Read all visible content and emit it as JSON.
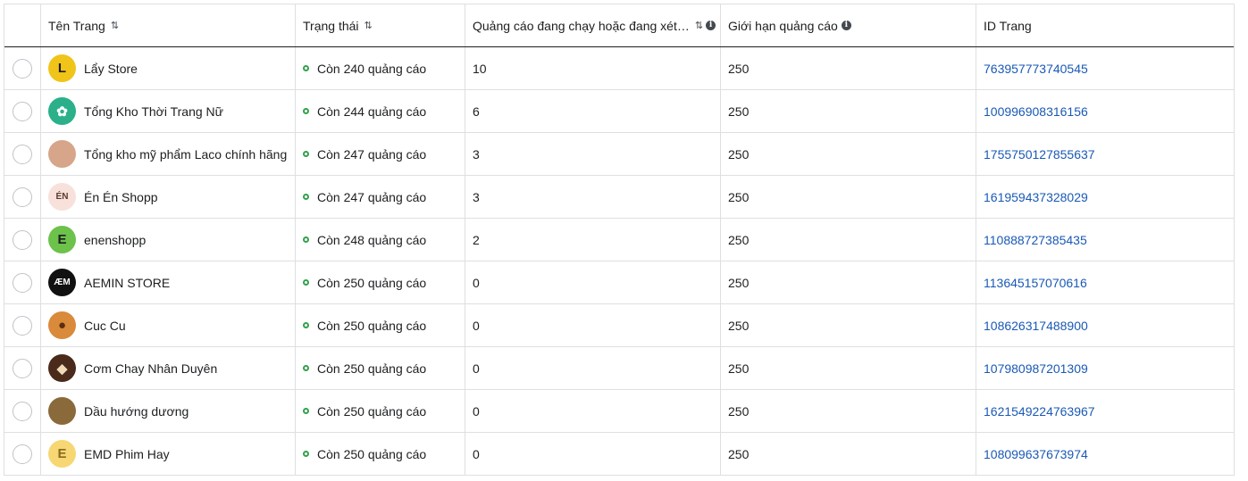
{
  "columns": {
    "name": "Tên Trang",
    "status": "Trạng thái",
    "ads_running": "Quảng cáo đang chạy hoặc đang xét…",
    "ad_limit": "Giới hạn quảng cáo",
    "page_id": "ID Trang"
  },
  "icons": {
    "sort": "sort-icon",
    "info": "info-icon",
    "status": "status-dot-icon"
  },
  "colors": {
    "status_green": "#31a24c",
    "link_blue": "#1a59b5",
    "border": "#dddfe2"
  },
  "rows": [
    {
      "name": "Lẩy Store",
      "status": "Còn 240 quảng cáo",
      "ads_running": "10",
      "ad_limit": "250",
      "page_id": "763957773740545",
      "avatar_text": "L",
      "avatar_bg": "#f0c419",
      "avatar_fg": "#1c1e21"
    },
    {
      "name": "Tổng Kho Thời Trang Nữ",
      "status": "Còn 244 quảng cáo",
      "ads_running": "6",
      "ad_limit": "250",
      "page_id": "100996908316156",
      "avatar_text": "✿",
      "avatar_bg": "#2bb08a",
      "avatar_fg": "#ffffff"
    },
    {
      "name": "Tổng kho mỹ phẩm Laco chính hãng",
      "status": "Còn 247 quảng cáo",
      "ads_running": "3",
      "ad_limit": "250",
      "page_id": "1755750127855637",
      "avatar_text": "",
      "avatar_bg": "#d6a58a",
      "avatar_fg": "#ffffff"
    },
    {
      "name": "Én Én Shopp",
      "status": "Còn 247 quảng cáo",
      "ads_running": "3",
      "ad_limit": "250",
      "page_id": "161959437328029",
      "avatar_text": "ÉN",
      "avatar_bg": "#f7e1da",
      "avatar_fg": "#5a3b2e"
    },
    {
      "name": "enenshopp",
      "status": "Còn 248 quảng cáo",
      "ads_running": "2",
      "ad_limit": "250",
      "page_id": "110888727385435",
      "avatar_text": "E",
      "avatar_bg": "#6cc24a",
      "avatar_fg": "#1c1e21"
    },
    {
      "name": "AEMIN STORE",
      "status": "Còn 250 quảng cáo",
      "ads_running": "0",
      "ad_limit": "250",
      "page_id": "113645157070616",
      "avatar_text": "ÆM",
      "avatar_bg": "#111111",
      "avatar_fg": "#ffffff"
    },
    {
      "name": "Cuc Cu",
      "status": "Còn 250 quảng cáo",
      "ads_running": "0",
      "ad_limit": "250",
      "page_id": "108626317488900",
      "avatar_text": "●",
      "avatar_bg": "#d98a3a",
      "avatar_fg": "#5a2e10"
    },
    {
      "name": "Cơm Chay Nhân Duyên",
      "status": "Còn 250 quảng cáo",
      "ads_running": "0",
      "ad_limit": "250",
      "page_id": "107980987201309",
      "avatar_text": "◆",
      "avatar_bg": "#4a2a1a",
      "avatar_fg": "#f0d9b5"
    },
    {
      "name": "Dầu hướng dương",
      "status": "Còn 250 quảng cáo",
      "ads_running": "0",
      "ad_limit": "250",
      "page_id": "1621549224763967",
      "avatar_text": "",
      "avatar_bg": "#8a6a3a",
      "avatar_fg": "#ffffff"
    },
    {
      "name": "EMD Phim Hay",
      "status": "Còn 250 quảng cáo",
      "ads_running": "0",
      "ad_limit": "250",
      "page_id": "108099637673974",
      "avatar_text": "E",
      "avatar_bg": "#f7d774",
      "avatar_fg": "#8a6a1a"
    }
  ]
}
